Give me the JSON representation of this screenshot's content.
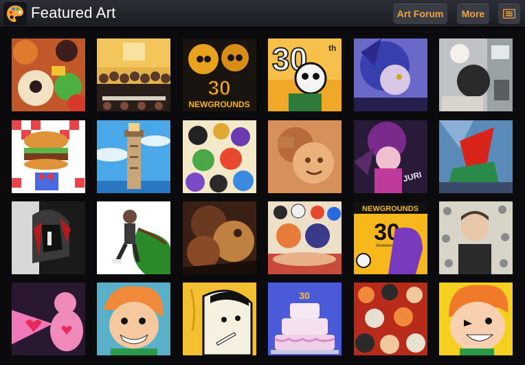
{
  "header": {
    "title": "Featured Art",
    "forum_label": "Art Forum",
    "more_label": "More",
    "logo_icon": "palette-icon",
    "menu_icon": "menu-icon"
  },
  "colors": {
    "accent": "#f6a53a",
    "header_bg": "#24272e",
    "page_bg": "#0b0b0d"
  },
  "gallery": {
    "rows": [
      [
        {
          "thumb_text": ""
        },
        {
          "thumb_text": ""
        },
        {
          "thumb_text": "30",
          "caption": "NEWGROUNDS"
        },
        {
          "thumb_text": "30",
          "sup": "th"
        },
        {
          "thumb_text": ""
        },
        {
          "thumb_text": ""
        }
      ],
      [
        {
          "thumb_text": ""
        },
        {
          "thumb_text": ""
        },
        {
          "thumb_text": ""
        },
        {
          "thumb_text": ""
        },
        {
          "thumb_text": "JURI"
        },
        {
          "thumb_text": ""
        }
      ],
      [
        {
          "thumb_text": ""
        },
        {
          "thumb_text": ""
        },
        {
          "thumb_text": ""
        },
        {
          "thumb_text": ""
        },
        {
          "thumb_text": "30",
          "caption": "NEWGROUNDS",
          "sub": "Anniversary"
        },
        {
          "thumb_text": ""
        }
      ],
      [
        {
          "thumb_text": ""
        },
        {
          "thumb_text": ""
        },
        {
          "thumb_text": ""
        },
        {
          "thumb_text": "30"
        },
        {
          "thumb_text": ""
        },
        {
          "thumb_text": ""
        }
      ]
    ]
  }
}
